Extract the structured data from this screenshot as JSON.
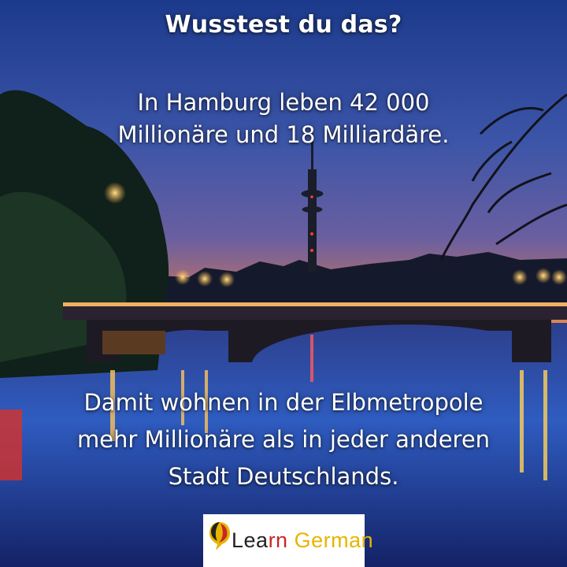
{
  "post": {
    "title": "Wusstest du das?",
    "fact_line_1": "In Hamburg leben 42 000",
    "fact_line_2": "Millionäre und 18 Milliardäre.",
    "detail_line_1": "Damit wohnen in der Elbmetropole",
    "detail_line_2": "mehr Millionäre als in jeder anderen",
    "detail_line_3": "Stadt Deutschlands."
  },
  "logo": {
    "word_part_1": "Lea",
    "word_part_2": "rn",
    "word_part_3": " German",
    "colors": [
      "#222222",
      "#c62828",
      "#e8b400"
    ]
  },
  "photo": {
    "subject": "Hamburg TV tower and bridge over the Alster at dusk"
  }
}
